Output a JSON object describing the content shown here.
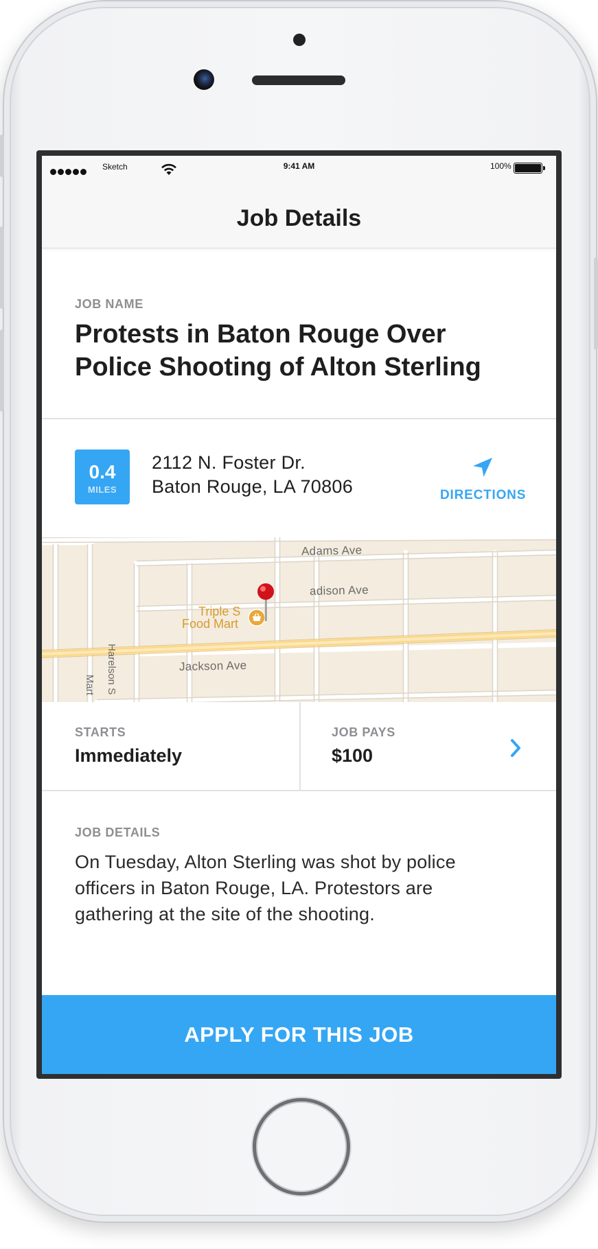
{
  "status_bar": {
    "carrier": "Sketch",
    "time": "9:41 AM",
    "battery_percent": "100%"
  },
  "nav": {
    "title": "Job Details"
  },
  "job_name": {
    "label": "JOB NAME",
    "title": "Protests in Baton Rouge Over Police Shooting of Alton Sterling"
  },
  "location": {
    "distance_value": "0.4",
    "distance_unit": "MILES",
    "address_line1": "2112 N. Foster Dr.",
    "address_line2": "Baton Rouge, LA 70806",
    "directions_label": "DIRECTIONS"
  },
  "map": {
    "labels": {
      "adams": "Adams Ave",
      "madison": "adison Ave",
      "jackson": "Jackson Ave",
      "harelson": "Harelson S",
      "mart": "Mart",
      "poi_line1": "Triple S",
      "poi_line2": "Food Mart"
    }
  },
  "starts": {
    "label": "STARTS",
    "value": "Immediately"
  },
  "pays": {
    "label": "JOB PAYS",
    "value": "$100"
  },
  "details": {
    "label": "JOB DETAILS",
    "text": "On Tuesday, Alton Sterling was shot by police officers in Baton Rouge, LA. Protestors are gathering at the site of the shooting."
  },
  "apply_button": {
    "label": "APPLY FOR THIS JOB"
  },
  "colors": {
    "accent": "#35a6f3",
    "pin": "#d0121b",
    "poi": "#e8a93a"
  }
}
